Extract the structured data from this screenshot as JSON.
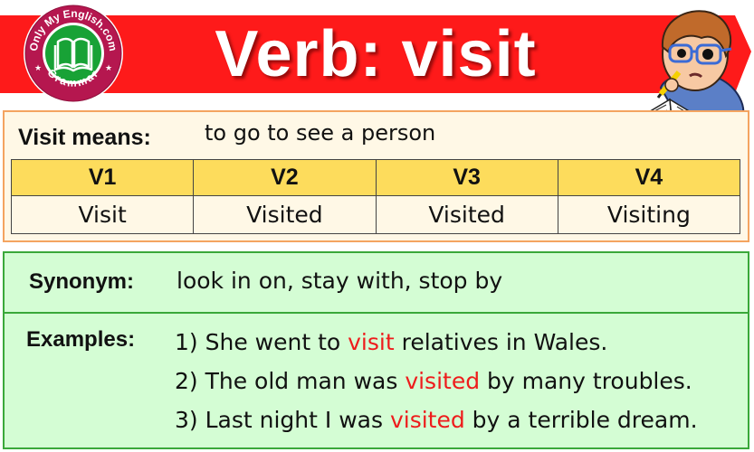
{
  "header": {
    "title": "Verb: visit",
    "banner_color": "#fe1a1a",
    "logo": {
      "top_text": "Only My English.com",
      "bottom_text": "Grammar",
      "icon": "open-book-icon",
      "ring_color": "#b5174f",
      "center_color": "#18a236"
    },
    "illustration": "student-reading-book"
  },
  "meaning": {
    "label": "Visit means:",
    "value": "to go to see a person"
  },
  "forms_table": {
    "headers": [
      "V1",
      "V2",
      "V3",
      "V4"
    ],
    "values": [
      "Visit",
      "Visited",
      "Visited",
      "Visiting"
    ],
    "header_color": "#fddc5c"
  },
  "synonym": {
    "label": "Synonym:",
    "value": "look in on, stay with, stop by"
  },
  "examples": {
    "label": "Examples:",
    "highlight_color": "#ee1c1c",
    "items": [
      {
        "before": "1) She went to ",
        "highlight": "visit",
        "after": " relatives in Wales."
      },
      {
        "before": "2) The old man was ",
        "highlight": "visited",
        "after": " by many troubles."
      },
      {
        "before": "3) Last night I was ",
        "highlight": "visited",
        "after": " by a terrible dream."
      }
    ]
  }
}
